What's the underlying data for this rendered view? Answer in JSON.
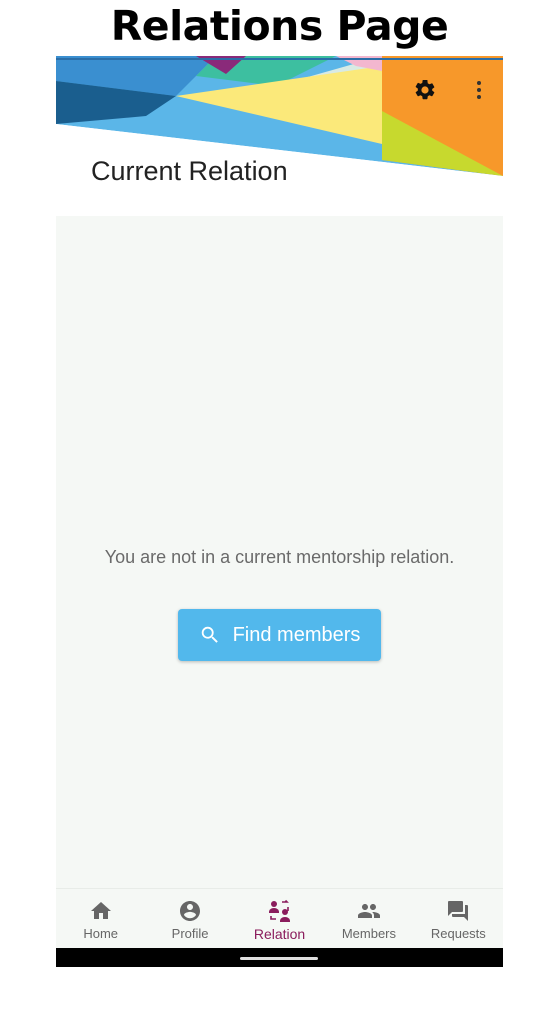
{
  "caption": "Relations Page",
  "header": {
    "title": "Current Relation",
    "actions": [
      {
        "icon": "gear-icon"
      },
      {
        "icon": "more-vert-icon"
      }
    ]
  },
  "main": {
    "empty_message": "You are not in a current mentorship relation.",
    "find_button": {
      "icon": "search-icon",
      "label": "Find members"
    }
  },
  "bottom_nav": {
    "items": [
      {
        "label": "Home",
        "icon": "home-icon",
        "active": false
      },
      {
        "label": "Profile",
        "icon": "account-circle-icon",
        "active": false
      },
      {
        "label": "Relation",
        "icon": "relation-icon",
        "active": true
      },
      {
        "label": "Members",
        "icon": "people-icon",
        "active": false
      },
      {
        "label": "Requests",
        "icon": "forum-icon",
        "active": false
      }
    ]
  },
  "colors": {
    "primary": "#52b8ec",
    "active_nav": "#8a1c5c",
    "background": "#f5f8f5"
  }
}
